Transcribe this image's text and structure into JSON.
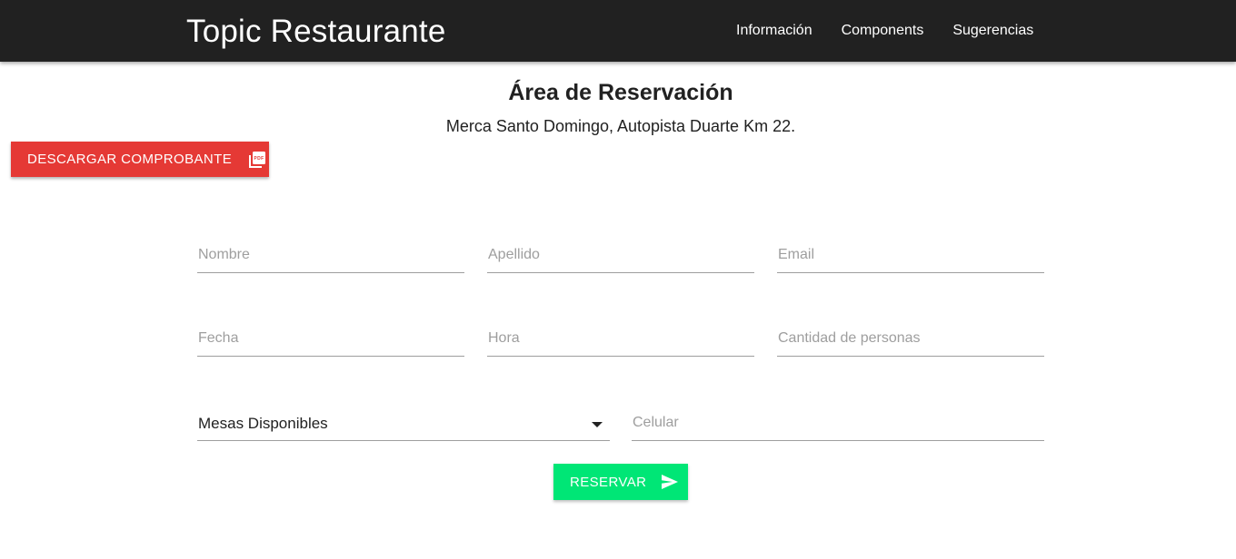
{
  "header": {
    "brand": "Topic Restaurante",
    "nav": [
      "Información",
      "Components",
      "Sugerencias"
    ]
  },
  "main": {
    "title": "Área de Reservación",
    "subtitle": "Merca Santo Domingo, Autopista Duarte Km 22.",
    "pdf_button": {
      "label": "DESCARGAR COMPROBANTE",
      "icon": "pdf-icon",
      "color": "#e53935"
    }
  },
  "form": {
    "nombre_placeholder": "Nombre",
    "apellido_placeholder": "Apellido",
    "email_placeholder": "Email",
    "fecha_placeholder": "Fecha",
    "hora_placeholder": "Hora",
    "personas_placeholder": "Cantidad de personas",
    "mesas_selected": "Mesas Disponibles",
    "celular_placeholder": "Celular",
    "reserve_button": {
      "label": "RESERVAR",
      "icon": "send-icon",
      "color": "#00e676"
    }
  },
  "colors": {
    "navbar": "#212121",
    "accent_red": "#e53935",
    "accent_green": "#00e676"
  }
}
